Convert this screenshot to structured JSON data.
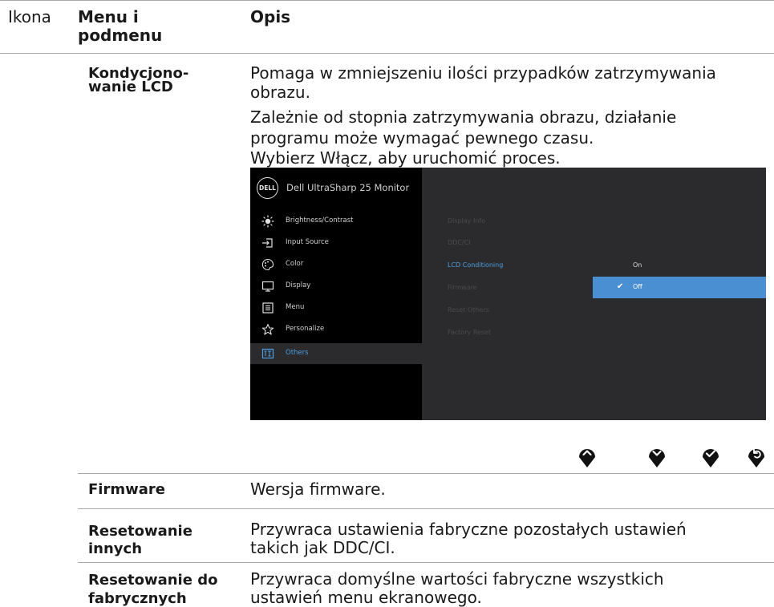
{
  "header": {
    "col1": "Ikona",
    "col2_line1": "Menu i",
    "col2_line2": "podmenu",
    "col3": "Opis"
  },
  "lcd_conditioning": {
    "name_line1": "Kondycjono-",
    "name_line2": "wanie LCD",
    "desc_lines": [
      "Pomaga w zmniejszeniu ilości przypadków zatrzymywania",
      "obrazu.",
      "Zależnie od stopnia zatrzymywania obrazu, działanie",
      "programu może wymagać pewnego czasu.",
      "Wybierz Włącz, aby uruchomić proces."
    ]
  },
  "osd": {
    "logo": "DELL",
    "model": "Dell UltraSharp 25 Monitor",
    "main_menu": [
      {
        "label": "Brightness/Contrast",
        "icon": "brightness-icon"
      },
      {
        "label": "Input Source",
        "icon": "input-source-icon"
      },
      {
        "label": "Color",
        "icon": "color-palette-icon"
      },
      {
        "label": "Display",
        "icon": "display-icon"
      },
      {
        "label": "Menu",
        "icon": "menu-icon"
      },
      {
        "label": "Personalize",
        "icon": "star-icon"
      },
      {
        "label": "Others",
        "icon": "others-icon"
      }
    ],
    "selected_main": "Others",
    "submenu": [
      "Display Info",
      "DDC/CI",
      "LCD Conditioning",
      "Firmware",
      "Reset Others",
      "Factory Reset"
    ],
    "active_submenu": "LCD Conditioning",
    "options": [
      "On",
      "Off"
    ],
    "selected_option": "Off",
    "colors": {
      "accent": "#4c9ce0",
      "option_highlight": "#4a8fd1",
      "panel_left": "#000000",
      "panel_mid": "#2b2b2d",
      "panel_right": "#222224"
    }
  },
  "nav_buttons": [
    "up-icon",
    "down-icon",
    "check-icon",
    "back-icon"
  ],
  "rows": [
    {
      "name_lines": [
        "Firmware"
      ],
      "desc_lines": [
        "Wersja firmware."
      ]
    },
    {
      "name_lines": [
        "Resetowanie",
        "innych"
      ],
      "desc_lines": [
        "Przywraca ustawienia fabryczne pozostałych ustawień",
        "takich jak DDC/CI."
      ]
    },
    {
      "name_lines": [
        "Resetowanie do",
        "fabrycznych"
      ],
      "desc_lines": [
        "Przywraca domyślne wartości fabryczne wszystkich",
        "ustawień menu ekranowego."
      ]
    }
  ]
}
